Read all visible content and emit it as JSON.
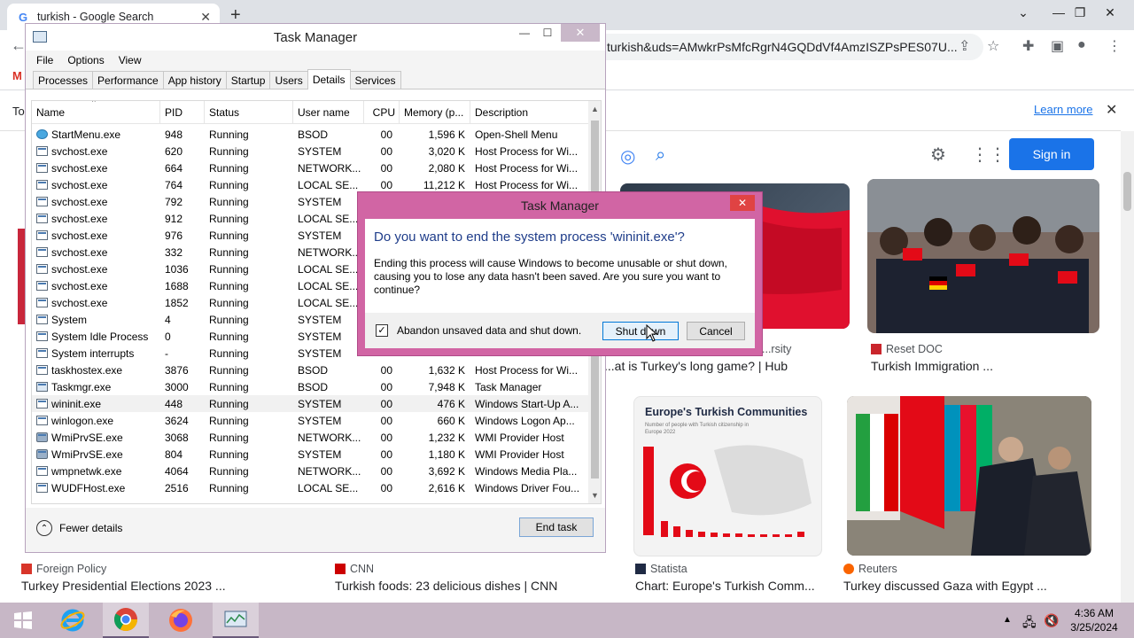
{
  "browser": {
    "tab_title": "turkish - Google Search",
    "url": "turkish&uds=AMwkrPsMfcRgrN4GQDdVf4AmzISZPsPES07U...",
    "learn_more": "Learn more",
    "sign_in": "Sign in"
  },
  "results": {
    "row1": [
      {
        "source": "",
        "title": ""
      },
      {
        "source": "...rsity",
        "title": "...at is Turkey's long game? | Hub"
      },
      {
        "source": "Reset DOC",
        "title": "Turkish Immigration ..."
      }
    ],
    "row2": [
      {
        "source": "Foreign Policy",
        "title": "Turkey Presidential Elections 2023 ..."
      },
      {
        "source": "CNN",
        "title": "Turkish foods: 23 delicious dishes | CNN"
      },
      {
        "source": "Statista",
        "title": "Chart: Europe's Turkish Comm..."
      },
      {
        "source": "Reuters",
        "title": "Turkey discussed Gaza with Egypt ..."
      }
    ],
    "statista_card_title": "Europe's Turkish Communities",
    "statista_card_sub": "Number of people with Turkish citizenship in Europe 2022"
  },
  "taskmanager": {
    "title": "Task Manager",
    "menu": [
      "File",
      "Options",
      "View"
    ],
    "tabs": [
      "Processes",
      "Performance",
      "App history",
      "Startup",
      "Users",
      "Details",
      "Services"
    ],
    "active_tab": "Details",
    "columns": [
      "Name",
      "PID",
      "Status",
      "User name",
      "CPU",
      "Memory (p...",
      "Description"
    ],
    "rows": [
      {
        "icon": "globe",
        "name": "StartMenu.exe",
        "pid": "948",
        "status": "Running",
        "user": "BSOD",
        "cpu": "00",
        "mem": "1,596 K",
        "desc": "Open-Shell Menu"
      },
      {
        "icon": "win",
        "name": "svchost.exe",
        "pid": "620",
        "status": "Running",
        "user": "SYSTEM",
        "cpu": "00",
        "mem": "3,020 K",
        "desc": "Host Process for Wi..."
      },
      {
        "icon": "win",
        "name": "svchost.exe",
        "pid": "664",
        "status": "Running",
        "user": "NETWORK...",
        "cpu": "00",
        "mem": "2,080 K",
        "desc": "Host Process for Wi..."
      },
      {
        "icon": "win",
        "name": "svchost.exe",
        "pid": "764",
        "status": "Running",
        "user": "LOCAL SE...",
        "cpu": "00",
        "mem": "11,212 K",
        "desc": "Host Process for Wi..."
      },
      {
        "icon": "win",
        "name": "svchost.exe",
        "pid": "792",
        "status": "Running",
        "user": "SYSTEM",
        "cpu": "",
        "mem": "",
        "desc": ""
      },
      {
        "icon": "win",
        "name": "svchost.exe",
        "pid": "912",
        "status": "Running",
        "user": "LOCAL SE...",
        "cpu": "",
        "mem": "",
        "desc": ""
      },
      {
        "icon": "win",
        "name": "svchost.exe",
        "pid": "976",
        "status": "Running",
        "user": "SYSTEM",
        "cpu": "",
        "mem": "",
        "desc": ""
      },
      {
        "icon": "win",
        "name": "svchost.exe",
        "pid": "332",
        "status": "Running",
        "user": "NETWORK...",
        "cpu": "",
        "mem": "",
        "desc": ""
      },
      {
        "icon": "win",
        "name": "svchost.exe",
        "pid": "1036",
        "status": "Running",
        "user": "LOCAL SE...",
        "cpu": "",
        "mem": "",
        "desc": ""
      },
      {
        "icon": "win",
        "name": "svchost.exe",
        "pid": "1688",
        "status": "Running",
        "user": "LOCAL SE...",
        "cpu": "",
        "mem": "",
        "desc": ""
      },
      {
        "icon": "win",
        "name": "svchost.exe",
        "pid": "1852",
        "status": "Running",
        "user": "LOCAL SE...",
        "cpu": "",
        "mem": "",
        "desc": ""
      },
      {
        "icon": "win",
        "name": "System",
        "pid": "4",
        "status": "Running",
        "user": "SYSTEM",
        "cpu": "",
        "mem": "",
        "desc": ""
      },
      {
        "icon": "win",
        "name": "System Idle Process",
        "pid": "0",
        "status": "Running",
        "user": "SYSTEM",
        "cpu": "",
        "mem": "",
        "desc": ""
      },
      {
        "icon": "win",
        "name": "System interrupts",
        "pid": "-",
        "status": "Running",
        "user": "SYSTEM",
        "cpu": "",
        "mem": "",
        "desc": ""
      },
      {
        "icon": "win",
        "name": "taskhostex.exe",
        "pid": "3876",
        "status": "Running",
        "user": "BSOD",
        "cpu": "00",
        "mem": "1,632 K",
        "desc": "Host Process for Wi..."
      },
      {
        "icon": "chart",
        "name": "Taskmgr.exe",
        "pid": "3000",
        "status": "Running",
        "user": "BSOD",
        "cpu": "00",
        "mem": "7,948 K",
        "desc": "Task Manager"
      },
      {
        "icon": "win",
        "name": "wininit.exe",
        "pid": "448",
        "status": "Running",
        "user": "SYSTEM",
        "cpu": "00",
        "mem": "476 K",
        "desc": "Windows Start-Up A...",
        "selected": true
      },
      {
        "icon": "win",
        "name": "winlogon.exe",
        "pid": "3624",
        "status": "Running",
        "user": "SYSTEM",
        "cpu": "00",
        "mem": "660 K",
        "desc": "Windows Logon Ap..."
      },
      {
        "icon": "gear",
        "name": "WmiPrvSE.exe",
        "pid": "3068",
        "status": "Running",
        "user": "NETWORK...",
        "cpu": "00",
        "mem": "1,232 K",
        "desc": "WMI Provider Host"
      },
      {
        "icon": "gear",
        "name": "WmiPrvSE.exe",
        "pid": "804",
        "status": "Running",
        "user": "SYSTEM",
        "cpu": "00",
        "mem": "1,180 K",
        "desc": "WMI Provider Host"
      },
      {
        "icon": "win",
        "name": "wmpnetwk.exe",
        "pid": "4064",
        "status": "Running",
        "user": "NETWORK...",
        "cpu": "00",
        "mem": "3,692 K",
        "desc": "Windows Media Pla..."
      },
      {
        "icon": "win",
        "name": "WUDFHost.exe",
        "pid": "2516",
        "status": "Running",
        "user": "LOCAL SE...",
        "cpu": "00",
        "mem": "2,616 K",
        "desc": "Windows Driver Fou..."
      }
    ],
    "fewer_details": "Fewer details",
    "end_task": "End task"
  },
  "dialog": {
    "title": "Task Manager",
    "question": "Do you want to end the system process 'wininit.exe'?",
    "message": "Ending this process will cause Windows to become unusable or shut down, causing you to lose any data hasn't been saved. Are you sure you want to continue?",
    "checkbox_label": "Abandon unsaved data and shut down.",
    "checkbox_checked": true,
    "shutdown_label": "Shut down",
    "cancel_label": "Cancel"
  },
  "taskbar": {
    "time": "4:36 AM",
    "date": "3/25/2024"
  },
  "colors": {
    "dialog_frame": "#d165a4",
    "taskbar": "#c7b7c6",
    "google_blue": "#1a73e8"
  }
}
